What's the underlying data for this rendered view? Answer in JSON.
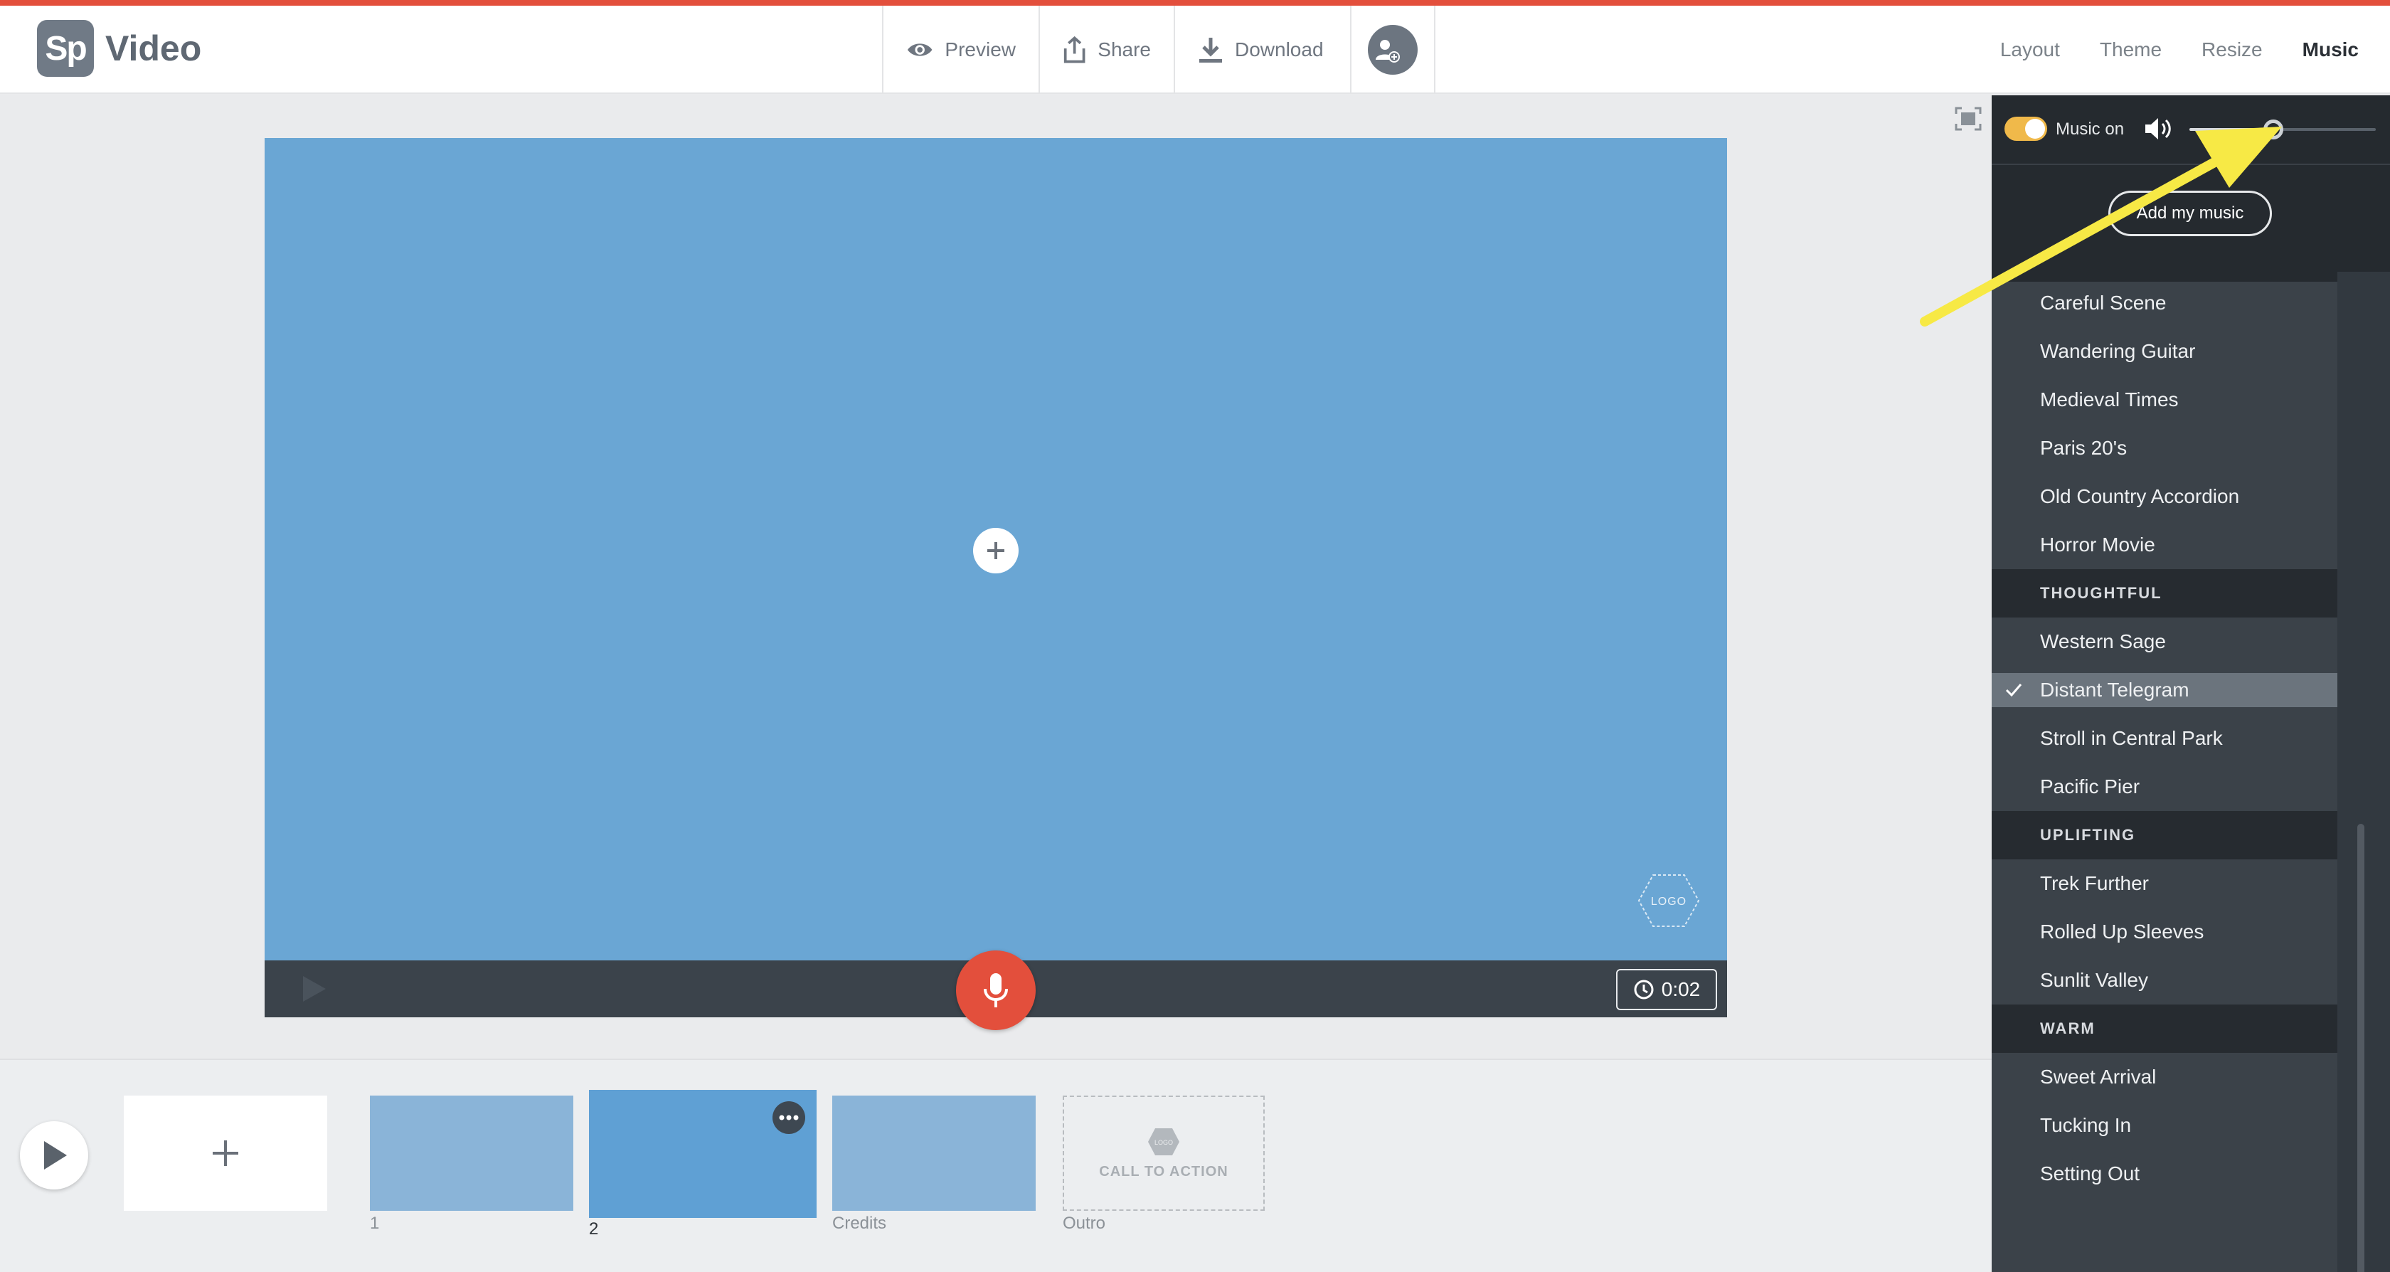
{
  "app": {
    "logo_mark": "Sp",
    "logo_text": "Video"
  },
  "toolbar": {
    "preview_label": "Preview",
    "share_label": "Share",
    "download_label": "Download"
  },
  "nav": {
    "layout": "Layout",
    "theme": "Theme",
    "resize": "Resize",
    "music": "Music",
    "active": "Music"
  },
  "stage": {
    "timer": "0:02",
    "logo_badge": "LOGO",
    "colors": {
      "canvas": "#6aa6d4",
      "controls": "#3b434b",
      "mic": "#e34f3c"
    }
  },
  "timeline": {
    "scenes": [
      {
        "label": "1"
      },
      {
        "label": "2"
      },
      {
        "label": "Credits"
      },
      {
        "label": "Outro",
        "placeholder": "CALL TO ACTION"
      }
    ]
  },
  "music_panel": {
    "toggle_label": "Music on",
    "volume": 0.45,
    "add_button": "Add my music",
    "groups": [
      {
        "category": "",
        "tracks": [
          "Careful Scene",
          "Wandering Guitar",
          "Medieval Times",
          "Paris 20's",
          "Old Country Accordion",
          "Horror Movie"
        ]
      },
      {
        "category": "THOUGHTFUL",
        "tracks": [
          "Western Sage",
          "Distant Telegram",
          "Stroll in Central Park",
          "Pacific Pier"
        ]
      },
      {
        "category": "UPLIFTING",
        "tracks": [
          "Trek Further",
          "Rolled Up Sleeves",
          "Sunlit Valley"
        ]
      },
      {
        "category": "WARM",
        "tracks": [
          "Sweet Arrival",
          "Tucking In",
          "Setting Out"
        ]
      }
    ],
    "selected_track": "Distant Telegram"
  },
  "annotation": {
    "color": "#f7e945",
    "target": "volume slider"
  }
}
